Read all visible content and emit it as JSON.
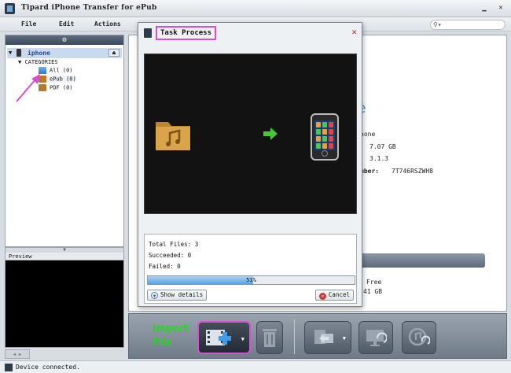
{
  "window": {
    "title": "Tipard iPhone Transfer for ePub"
  },
  "menu": [
    {
      "label": "File",
      "x": 0
    },
    {
      "label": "Edit"
    },
    {
      "label": "Actions"
    }
  ],
  "search": {
    "placeholder": ""
  },
  "sidebar": {
    "device": "iphone",
    "categories_label": "CATEGORIES",
    "items": [
      {
        "label": "All (0)",
        "icon": "all-icon"
      },
      {
        "label": "ePub (0)",
        "icon": "epub-icon"
      },
      {
        "label": "PDF (0)",
        "icon": "pdf-icon"
      }
    ]
  },
  "preview": {
    "label": "Preview"
  },
  "status": {
    "text": "Device connected."
  },
  "device_info": {
    "heading_fragment": "e",
    "line1": "hone",
    "capacity": "7.07 GB",
    "version": "3.1.3",
    "serial_label": "mber:",
    "serial": "7T746RSZWH8",
    "free_label": "Free",
    "free_value": "41 GB"
  },
  "toolbar": {
    "import_label_line1": "Import",
    "import_label_line2": "File"
  },
  "dialog": {
    "title": "Task Process",
    "total_files": "Total Files: 3",
    "succeeded": "Succeeded: 0",
    "failed": "Failed: 0",
    "progress_pct": "51%",
    "progress_value": 0.51,
    "show_details": "Show details",
    "cancel": "Cancel"
  },
  "colors": {
    "highlight": "#d94fd2",
    "progress": "#5aa3e4",
    "import_label": "#28d428"
  }
}
